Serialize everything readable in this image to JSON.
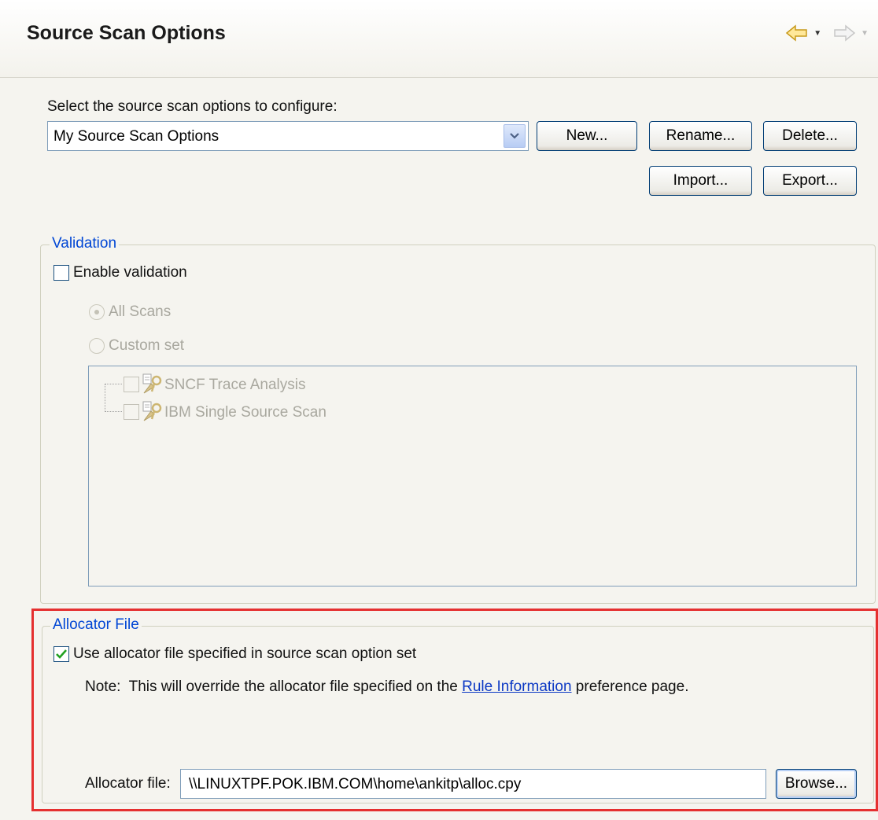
{
  "header": {
    "title": "Source Scan Options",
    "back_icon": "back-arrow-icon",
    "forward_icon": "forward-arrow-icon"
  },
  "config": {
    "prompt": "Select the source scan options to configure:",
    "selected": "My Source Scan Options",
    "buttons": {
      "new": "New...",
      "rename": "Rename...",
      "delete": "Delete...",
      "import": "Import...",
      "export": "Export..."
    }
  },
  "validation": {
    "legend": "Validation",
    "enable_label": "Enable validation",
    "enabled": false,
    "radio_all": "All Scans",
    "radio_custom": "Custom set",
    "selected_radio": "All Scans",
    "items": [
      {
        "label": "SNCF Trace Analysis",
        "checked": false
      },
      {
        "label": "IBM Single Source Scan",
        "checked": false
      }
    ]
  },
  "allocator": {
    "legend": "Allocator File",
    "use_label": "Use allocator file specified in source scan option set",
    "use_checked": true,
    "note_prefix": "Note:  This will override the allocator file specified on the ",
    "note_link": "Rule Information",
    "note_suffix": " preference page.",
    "field_label": "Allocator file:",
    "field_value": "\\\\LINUXTPF.POK.IBM.COM\\home\\ankitp\\alloc.cpy",
    "browse": "Browse..."
  },
  "colors": {
    "highlight_frame": "#e53030",
    "legend_text": "#0046d5",
    "link": "#0b38c4"
  }
}
